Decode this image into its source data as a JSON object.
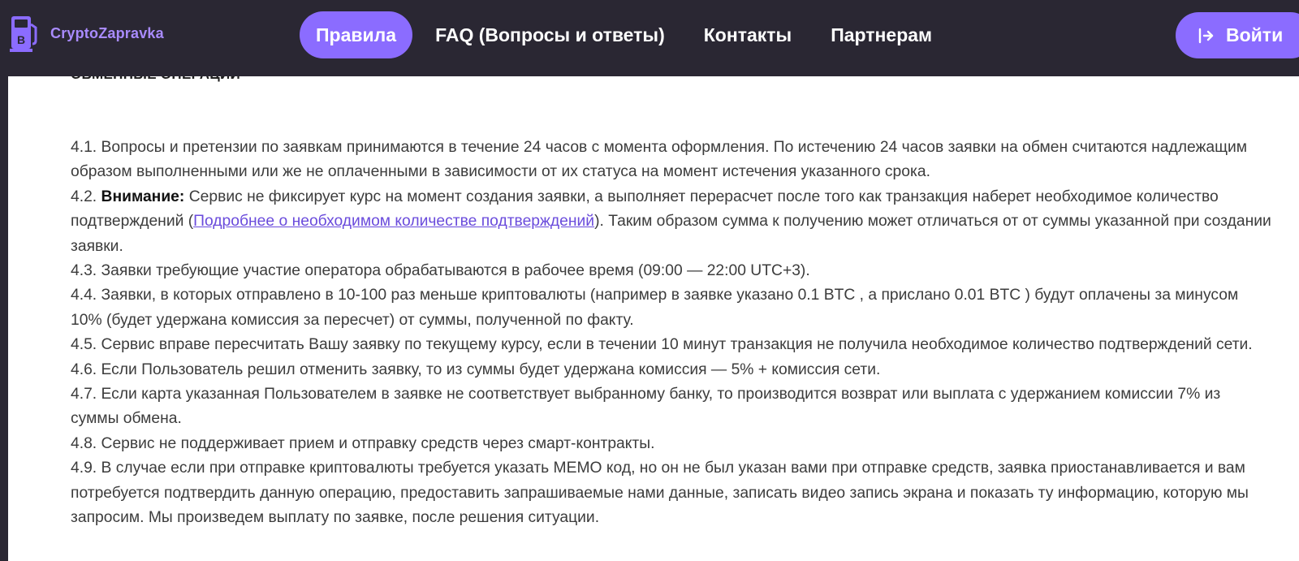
{
  "header": {
    "logo_text": "CryptoZapravka",
    "nav": [
      {
        "label": "Правила",
        "active": true
      },
      {
        "label": "FAQ (Вопросы и ответы)",
        "active": false
      },
      {
        "label": "Контакты",
        "active": false
      },
      {
        "label": "Партнерам",
        "active": false
      }
    ],
    "login_label": "Войти",
    "accent_color": "#8b6cff"
  },
  "section_title": "Обменные операции",
  "rules": {
    "r1": "4.1. Вопросы и претензии по заявкам принимаются в течение 24 часов с момента оформления. По истечению 24 часов заявки на обмен считаются надлежащим образом выполненными или же не оплаченными в зависимости от их статуса на момент истечения указанного срока.",
    "r2_prefix": "4.2. ",
    "r2_bold": "Внимание:",
    "r2_text1": " Сервис не фиксирует курс на момент создания заявки, а выполняет перерасчет после того как транзакция наберет необходимое количество подтверждений (",
    "r2_link": "Подробнее о необходимом количестве подтверждений",
    "r2_text2": "). Таким образом сумма к получению может отличаться от от суммы указанной при создании заявки.",
    "r3": "4.3. Заявки требующие участие оператора обрабатываются в рабочее время (09:00 — 22:00 UTC+3).",
    "r4": "4.4. Заявки, в которых отправлено в 10-100 раз меньше криптовалюты (например в заявке указано 0.1 BTC , а прислано 0.01 BTC ) будут оплачены за минусом 10% (будет удержана комиссия за пересчет) от суммы, полученной по факту.",
    "r5": "4.5. Сервис вправе пересчитать Вашу заявку по текущему курсу, если в течении 10 минут транзакция не получила необходимое количество подтверждений сети.",
    "r6": "4.6. Если Пользователь решил отменить заявку, то из суммы будет удержана комиссия — 5% + комиссия сети.",
    "r7": "4.7.  Если карта указанная Пользователем в заявке не соответствует выбранному банку, то производится возврат или выплата с удержанием комиссии 7% из суммы обмена.",
    "r8": "4.8. Сервис не поддерживает прием и отправку средств через смарт-контракты.",
    "r9": "4.9. В случае если при отправке криптовалюты требуется указать MEMO код, но он не был указан вами при отправке средств, заявка приостанавливается и вам потребуется подтвердить данную операцию, предоставить запрашиваемые нами данные, записать видео запись экрана и показать ту информацию, которую мы запросим. Мы произведем выплату по заявке, после решения ситуации."
  }
}
